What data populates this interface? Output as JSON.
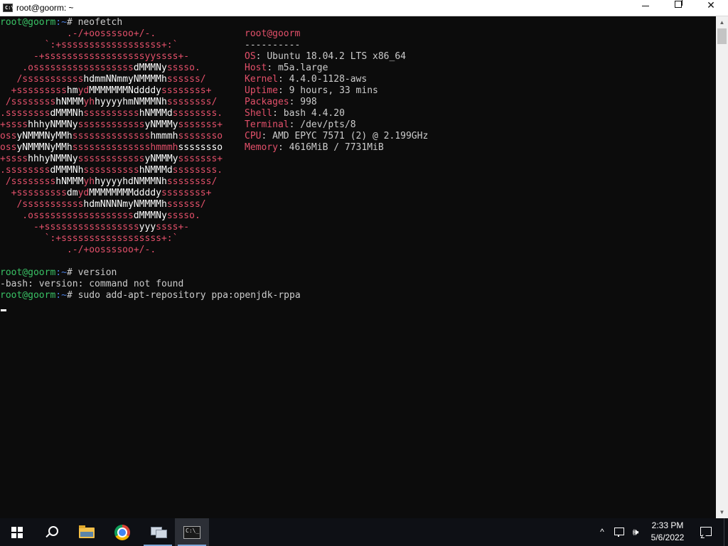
{
  "window": {
    "title": "root@goorm: ~",
    "icon": "cmd-icon",
    "controls": {
      "minimize": "minimize-icon",
      "maximize": "restore-icon",
      "close": "✕"
    }
  },
  "terminal": {
    "prompt_user": "root@goorm",
    "prompt_path": ":~",
    "prompt_symbol": "# ",
    "cmd1": "neofetch",
    "ascii": [
      [
        "            .-/+oossssoo+/-.",
        ""
      ],
      [
        "        `:+ssssssssssssssssss+:`",
        ""
      ],
      [
        "      -+ssssssssssssssssssyyssss+-",
        ""
      ],
      [
        "    .ossssssssssssssssss",
        "dMMMNy",
        "sssso."
      ],
      [
        "   /sssssssssss",
        "hdmmNNmmyNMMMMh",
        "ssssss/"
      ],
      [
        "  +sssssssss",
        "hm",
        "yd",
        "MMMMMMMNddddy",
        "ssssssss+"
      ],
      [
        " /ssssssss",
        "hNMMM",
        "yh",
        "hyyyyhmNMMMNh",
        "ssssssss/"
      ],
      [
        ".ssssssss",
        "dMMMNh",
        "ssssssssss",
        "hNMMMd",
        "ssssssss."
      ],
      [
        "+ssss",
        "hhhyNMMNy",
        "ssssssssssss",
        "yNMMMy",
        "sssssss+"
      ],
      [
        "oss",
        "yNMMMNyMMh",
        "ssssssssssssss",
        "hmmmh",
        "ssssssso"
      ],
      [
        "oss",
        "yNMMMNyMMh",
        "sssssssssssssshmmmh",
        "ssssssso"
      ],
      [
        "+ssss",
        "hhhyNMMNy",
        "ssssssssssss",
        "yNMMMy",
        "sssssss+"
      ],
      [
        ".ssssssss",
        "dMMMNh",
        "ssssssssss",
        "hNMMMd",
        "ssssssss."
      ],
      [
        " /ssssssss",
        "hNMMM",
        "yh",
        "hyyyyhdNMMMNh",
        "ssssssss/"
      ],
      [
        "  +sssssssss",
        "dm",
        "yd",
        "MMMMMMMMddddy",
        "ssssssss+"
      ],
      [
        "   /sssssssssss",
        "hdmNNNNmyNMMMMh",
        "ssssss/"
      ],
      [
        "    .ossssssssssssssssss",
        "dMMMNy",
        "sssso."
      ],
      [
        "      -+sssssssssssssssss",
        "yyy",
        "ssss+-"
      ],
      [
        "        `:+ssssssssssssssssss+:`",
        ""
      ],
      [
        "            .-/+oossssoo+/-.",
        ""
      ]
    ],
    "info": {
      "header": "root@goorm",
      "separator": "----------",
      "rows": [
        {
          "key": "OS",
          "value": "Ubuntu 18.04.2 LTS x86_64"
        },
        {
          "key": "Host",
          "value": "m5a.large"
        },
        {
          "key": "Kernel",
          "value": "4.4.0-1128-aws"
        },
        {
          "key": "Uptime",
          "value": "9 hours, 33 mins"
        },
        {
          "key": "Packages",
          "value": "998"
        },
        {
          "key": "Shell",
          "value": "bash 4.4.20"
        },
        {
          "key": "Terminal",
          "value": "/dev/pts/8"
        },
        {
          "key": "CPU",
          "value": "AMD EPYC 7571 (2) @ 2.199GHz"
        },
        {
          "key": "Memory",
          "value": "4616MiB / 7731MiB"
        }
      ]
    },
    "cmd2": "version",
    "error": "-bash: version: command not found",
    "cmd3": "sudo add-apt-repository ppa:openjdk-rppa"
  },
  "taskbar": {
    "apps": [
      "start-icon",
      "search-icon",
      "file-explorer-icon",
      "chrome-icon",
      "network-app-icon",
      "cmd-icon"
    ],
    "tray": {
      "chevron": "^",
      "volume": "🕪"
    },
    "clock": {
      "time": "2:33 PM",
      "date": "5/6/2022"
    }
  }
}
